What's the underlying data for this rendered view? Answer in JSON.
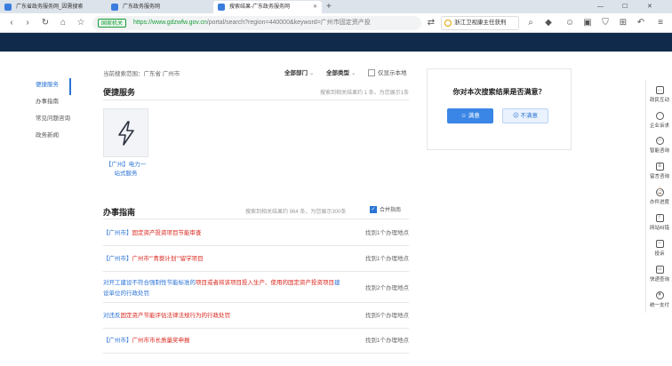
{
  "browser": {
    "tabs": [
      {
        "title": "广东省政务服务网_因需搜索"
      },
      {
        "title": "广东政务服务网"
      },
      {
        "title": "搜索结果-广东政务服务网"
      }
    ],
    "new_tab": "+",
    "secure_label": "国家机关",
    "url_host": "https://www.gdzwfw.gov.cn",
    "url_path": "/portal/search?region=440000&keyword=广州市固定资产投",
    "search_box": "浙江卫视康主任获刑"
  },
  "leftnav": {
    "items": [
      {
        "label": "便捷服务"
      },
      {
        "label": "办事指南"
      },
      {
        "label": "常见问题咨询"
      },
      {
        "label": "政务新闻"
      }
    ]
  },
  "filters": {
    "scope": "当前搜索范围：广东省 广州市",
    "dept": "全部部门",
    "type": "全部类型",
    "show_local": "仅显示本地"
  },
  "convenient": {
    "title": "便捷服务",
    "count": "搜索到相关结果约 1 条，为您展示1条",
    "card_label": "【广州】电力一站式服务"
  },
  "guide": {
    "title": "办事指南",
    "count": "搜索到相关结果约 964 条，为您展示300条",
    "merge": "合并指南",
    "items": [
      {
        "pre": "【广州市】",
        "hl": "固定资产投资项目节能审查",
        "post": "",
        "count": "找到1个办理地点"
      },
      {
        "pre": "【广州市】",
        "hl": "广州市“”青葵计划”“留学项目",
        "post": "",
        "count": "找到1个办理地点"
      },
      {
        "pre": "对开工建设不符合强制性节能标准的",
        "hl": "项目或者将该项目投入生产、使用的固定资产投资项目",
        "post": "建设单位的行政处罚",
        "count": "找到2个办理地点"
      },
      {
        "pre": "对违反",
        "hl": "固定资产节能评估法律法规行为的行政处罚",
        "post": "",
        "count": "找到5个办理地点"
      },
      {
        "pre": "【广州市】",
        "hl": "广州市市长质量奖申报",
        "post": "",
        "count": "找到1个办理地点"
      }
    ]
  },
  "survey": {
    "question": "你对本次搜索结果是否满意？",
    "yes": "满意",
    "no": "不满意"
  },
  "floatbar": {
    "items": [
      {
        "label": "政民互动"
      },
      {
        "label": "企业诉求"
      },
      {
        "label": "智能咨询"
      },
      {
        "label": "留言咨询"
      },
      {
        "label": "办件进度"
      },
      {
        "label": "网站纠错"
      },
      {
        "label": "投诉"
      },
      {
        "label": "快递查询"
      },
      {
        "label": "统一支付"
      }
    ]
  },
  "colors": {
    "accent": "#2a73d6",
    "highlight": "#d9261c",
    "banner": "#0f2a4a"
  }
}
